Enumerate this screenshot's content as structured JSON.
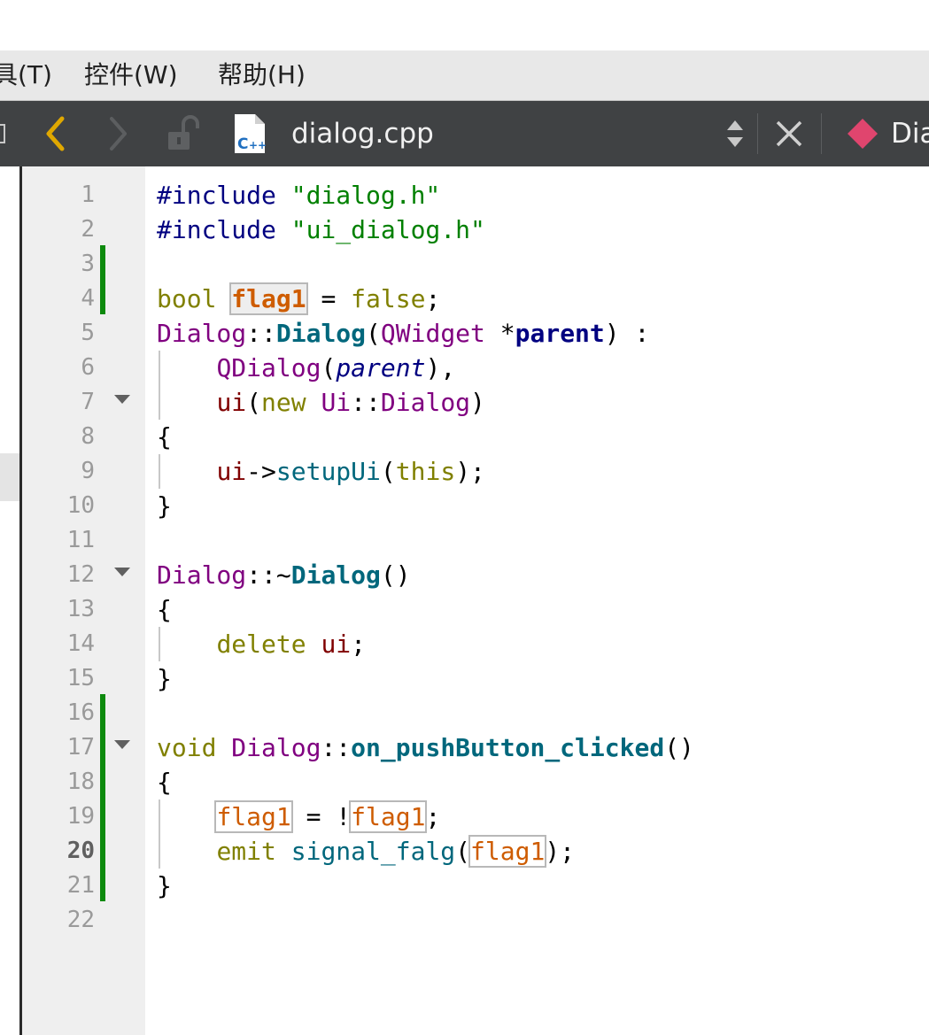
{
  "menu": {
    "tools": "具(T)",
    "widgets": "控件(W)",
    "help": "帮助(H)"
  },
  "toolbar": {
    "filename": "dialog.cpp",
    "class_name": "Dia"
  },
  "editor": {
    "current_line": 20,
    "line_numbers": [
      "1",
      "2",
      "3",
      "4",
      "5",
      "6",
      "7",
      "8",
      "9",
      "10",
      "11",
      "12",
      "13",
      "14",
      "15",
      "16",
      "17",
      "18",
      "19",
      "20",
      "21",
      "22"
    ],
    "code": {
      "l1": {
        "a": "#include",
        "b": " ",
        "c": "\"dialog.h\""
      },
      "l2": {
        "a": "#include",
        "b": " ",
        "c": "\"ui_dialog.h\""
      },
      "l4": {
        "a": "bool",
        "b": " ",
        "c": "flag1",
        "d": " = ",
        "e": "false",
        "f": ";"
      },
      "l5": {
        "a": "Dialog",
        "b": "::",
        "c": "Dialog",
        "d": "(",
        "e": "QWidget",
        "f": " *",
        "g": "parent",
        "h": ") :"
      },
      "l6": {
        "a": "QDialog",
        "b": "(",
        "c": "parent",
        "d": "),",
        "pad": "    "
      },
      "l7": {
        "a": "ui",
        "b": "(",
        "c": "new",
        "d": " ",
        "e": "Ui",
        "f": "::",
        "g": "Dialog",
        "h": ")",
        "pad": "    "
      },
      "l8": {
        "a": "{"
      },
      "l9": {
        "a": "ui",
        "b": "->",
        "c": "setupUi",
        "d": "(",
        "e": "this",
        "f": ");",
        "pad": "    "
      },
      "l10": {
        "a": "}"
      },
      "l12": {
        "a": "Dialog",
        "b": "::~",
        "c": "Dialog",
        "d": "()"
      },
      "l13": {
        "a": "{"
      },
      "l14": {
        "a": "delete",
        "b": " ",
        "c": "ui",
        "d": ";",
        "pad": "    "
      },
      "l15": {
        "a": "}"
      },
      "l17": {
        "a": "void",
        "b": " ",
        "c": "Dialog",
        "d": "::",
        "e": "on_pushButton_clicked",
        "f": "()"
      },
      "l18": {
        "a": "{"
      },
      "l19": {
        "a": "flag1",
        "b": " = !",
        "c": "flag1",
        "d": ";",
        "pad": "    "
      },
      "l20": {
        "a": "emit",
        "b": " ",
        "c": "signal_falg",
        "d": "(",
        "e": "flag1",
        "f": ");",
        "pad": "    "
      },
      "l21": {
        "a": "}"
      }
    }
  },
  "colors": {
    "menubar_bg": "#e8e8e8",
    "toolbar_bg": "#404244",
    "gutter_bg": "#efefef",
    "change_marker": "#0d8a0d",
    "back_arrow": "#e0a800",
    "class_icon": "#e0456e"
  },
  "icons": [
    "back-arrow-icon",
    "forward-arrow-icon",
    "lock-icon",
    "cpp-file-icon",
    "up-down-icon",
    "close-icon",
    "class-icon",
    "fold-arrow-icon"
  ]
}
